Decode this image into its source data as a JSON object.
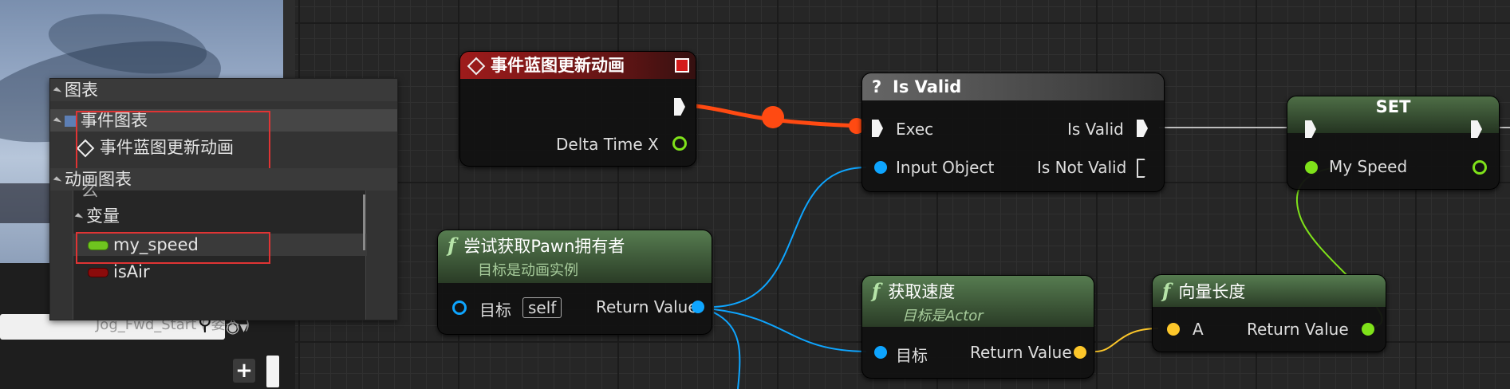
{
  "menu": {
    "graph_header": "图表",
    "event_graph": "事件图表",
    "event_update": "事件蓝图更新动画",
    "anim_graph": "动画图表",
    "partial": "么",
    "variables": "变量",
    "var_speed": "my_speed",
    "var_isair": "isAir",
    "var_partial": "Jog_Fwd_Start ( 姿态 )"
  },
  "nodes": {
    "event": {
      "title": "事件蓝图更新动画",
      "out_label": "Delta Time X"
    },
    "isvalid": {
      "title": "Is Valid",
      "exec": "Exec",
      "is_valid": "Is Valid",
      "input_object": "Input Object",
      "is_not_valid": "Is Not Valid"
    },
    "set": {
      "title": "SET",
      "my_speed": "My Speed"
    },
    "pawn": {
      "title": "尝试获取Pawn拥有者",
      "subtitle": "目标是动画实例",
      "target": "目标",
      "self": "self",
      "return": "Return Value"
    },
    "velocity": {
      "title": "获取速度",
      "subtitle": "目标是Actor",
      "target": "目标",
      "return": "Return Value"
    },
    "vlength": {
      "title": "向量长度",
      "input": "A",
      "return": "Return Value"
    }
  },
  "colors": {
    "exec_wire": "#ff4a12",
    "object_pin": "#0ea5ff",
    "float_pin": "#7fe21a",
    "vector_pin": "#fdc72a",
    "func_header": "#4a7a48",
    "event_header": "#9e1b1b",
    "selection": "#e03434"
  },
  "icons": [
    "diamond-event-icon",
    "function-icon",
    "question-icon",
    "search-icon",
    "eye-icon",
    "plus-icon"
  ]
}
